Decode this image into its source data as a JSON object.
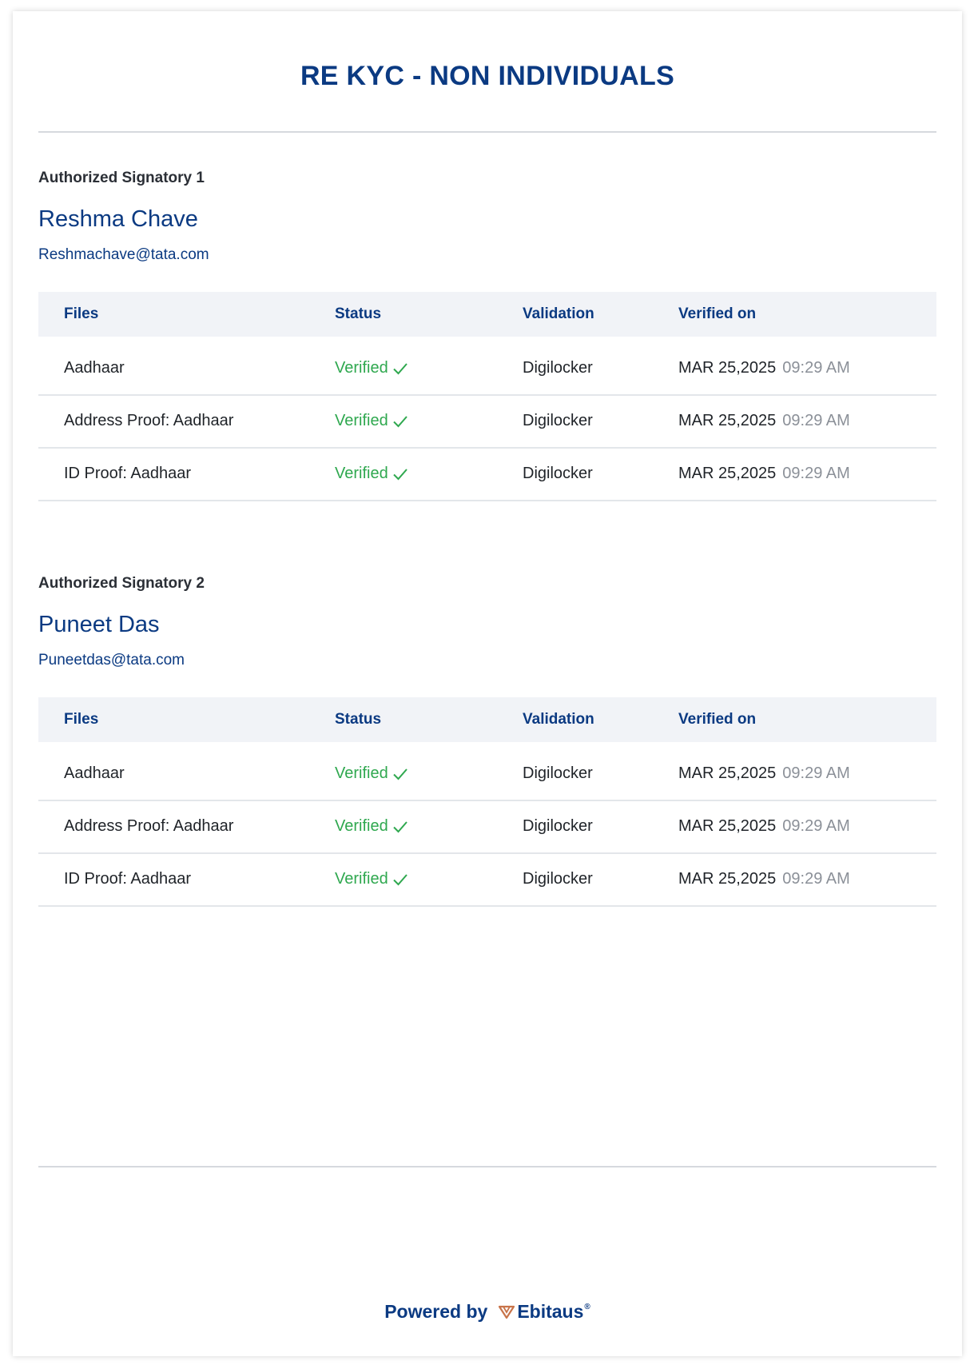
{
  "title": "RE KYC - NON INDIVIDUALS",
  "table_headers": {
    "files": "Files",
    "status": "Status",
    "validation": "Validation",
    "verified_on": "Verified on"
  },
  "signatories": [
    {
      "label": "Authorized Signatory 1",
      "name": "Reshma Chave",
      "email": "Reshmachave@tata.com",
      "rows": [
        {
          "file": "Aadhaar",
          "status": "Verified",
          "validation": "Digilocker",
          "date": "MAR 25,2025",
          "time": "09:29 AM"
        },
        {
          "file": "Address Proof: Aadhaar",
          "status": "Verified",
          "validation": "Digilocker",
          "date": "MAR 25,2025",
          "time": "09:29 AM"
        },
        {
          "file": "ID Proof: Aadhaar",
          "status": "Verified",
          "validation": "Digilocker",
          "date": "MAR 25,2025",
          "time": "09:29 AM"
        }
      ]
    },
    {
      "label": "Authorized Signatory 2",
      "name": "Puneet Das",
      "email": "Puneetdas@tata.com",
      "rows": [
        {
          "file": "Aadhaar",
          "status": "Verified",
          "validation": "Digilocker",
          "date": "MAR 25,2025",
          "time": "09:29 AM"
        },
        {
          "file": "Address Proof: Aadhaar",
          "status": "Verified",
          "validation": "Digilocker",
          "date": "MAR 25,2025",
          "time": "09:29 AM"
        },
        {
          "file": "ID Proof: Aadhaar",
          "status": "Verified",
          "validation": "Digilocker",
          "date": "MAR 25,2025",
          "time": "09:29 AM"
        }
      ]
    }
  ],
  "footer": {
    "powered_by": "Powered by",
    "brand": "Ebitaus",
    "brand_mark": "®"
  },
  "colors": {
    "primary": "#0b3a82",
    "verified": "#2fa84f",
    "muted_time": "#8b9098",
    "header_bg": "#f1f3f7",
    "brand_logo": "#c8744a"
  },
  "icons": {
    "status": "check-icon",
    "brand": "ebitaus-logo-icon"
  }
}
